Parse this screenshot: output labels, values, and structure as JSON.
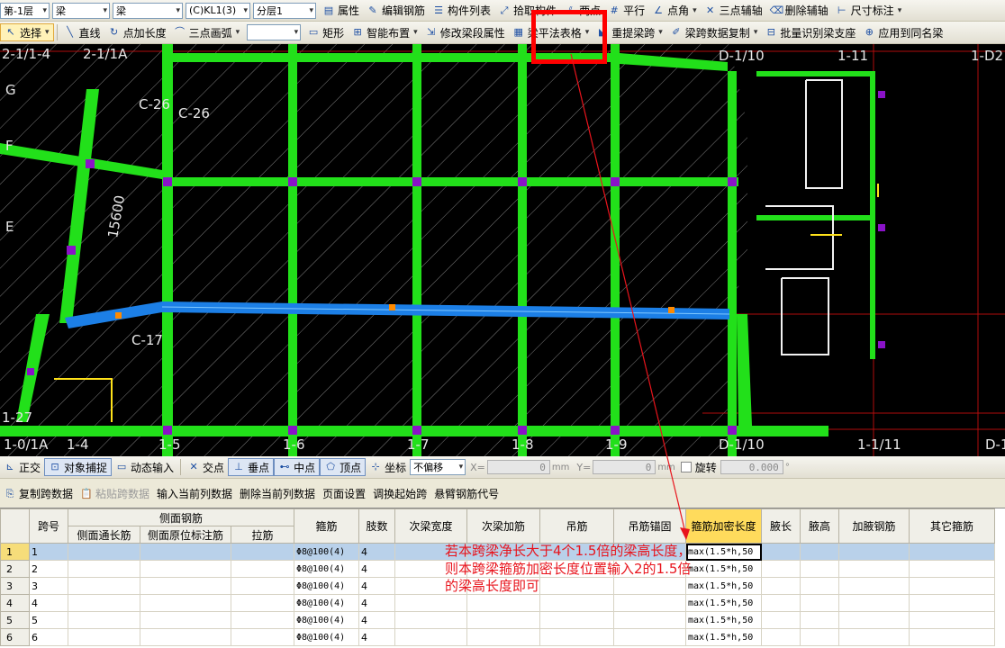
{
  "toolbar1": {
    "floor": "第-1层",
    "type1": "梁",
    "type2": "梁",
    "component": "(C)KL1(3)",
    "layer": "分层1",
    "items": [
      "属性",
      "编辑钢筋",
      "构件列表",
      "拾取构件",
      "两点",
      "平行",
      "点角",
      "三点辅轴",
      "删除辅轴",
      "尺寸标注"
    ]
  },
  "toolbar2": {
    "select": "选择",
    "items": [
      "直线",
      "点加长度",
      "三点画弧",
      "矩形",
      "智能布置",
      "修改梁段属性",
      "梁平法表格",
      "重提梁跨",
      "梁跨数据复制",
      "批量识别梁支座",
      "应用到同名梁"
    ]
  },
  "canvas": {
    "axis_labels": [
      "2-1/1-4",
      "2-1/1A",
      "D-1/10",
      "1-11",
      "1-D2",
      "1-0/1A",
      "1-4",
      "1-5",
      "1-6",
      "1-7",
      "1-8",
      "1-9",
      "D-1/10",
      "1-1/11",
      "D-1",
      "G",
      "F",
      "E",
      "C-26",
      "C-26",
      "C-17",
      "15600",
      "1-27"
    ]
  },
  "snapbar": {
    "items": [
      "正交",
      "对象捕捉",
      "动态输入",
      "交点",
      "垂点",
      "中点",
      "顶点",
      "坐标"
    ],
    "offset_mode": "不偏移",
    "x_label": "X=",
    "x_value": "0",
    "y_label": "Y=",
    "y_value": "0",
    "unit": "mm",
    "rotate_label": "旋转",
    "rotate_value": "0.000",
    "degree": "°"
  },
  "tablebar": {
    "items": [
      "复制跨数据",
      "粘贴跨数据",
      "输入当前列数据",
      "删除当前列数据",
      "页面设置",
      "调换起始跨",
      "悬臂钢筋代号"
    ]
  },
  "table": {
    "headers": {
      "span": "跨号",
      "side_group": "侧面钢筋",
      "side_long": "侧面通长筋",
      "side_orig": "侧面原位标注筋",
      "tie": "拉筋",
      "stirrup": "箍筋",
      "legs": "肢数",
      "sec_width": "次梁宽度",
      "sec_add": "次梁加筋",
      "hanger": "吊筋",
      "hanger_anchor": "吊筋锚固",
      "dense_len": "箍筋加密长度",
      "haunch_len": "腋长",
      "haunch_h": "腋高",
      "haunch_bar": "加腋钢筋",
      "other": "其它箍筋"
    },
    "rows": [
      {
        "idx": "1",
        "span": "1",
        "stirrup": "Φ8@100(4)",
        "legs": "4",
        "dense": "max(1.5*h,50"
      },
      {
        "idx": "2",
        "span": "2",
        "stirrup": "Φ8@100(4)",
        "legs": "4",
        "dense": "max(1.5*h,50"
      },
      {
        "idx": "3",
        "span": "3",
        "stirrup": "Φ8@100(4)",
        "legs": "4",
        "dense": "max(1.5*h,50"
      },
      {
        "idx": "4",
        "span": "4",
        "stirrup": "Φ8@100(4)",
        "legs": "4",
        "dense": "max(1.5*h,50"
      },
      {
        "idx": "5",
        "span": "5",
        "stirrup": "Φ8@100(4)",
        "legs": "4",
        "dense": "max(1.5*h,50"
      },
      {
        "idx": "6",
        "span": "6",
        "stirrup": "Φ8@100(4)",
        "legs": "4",
        "dense": "max(1.5*h,50"
      }
    ]
  },
  "annotation": "若本跨梁净长大于4个1.5倍的梁高长度，则本跨梁箍筋加密长度位置输入2的1.5倍的梁高长度即可",
  "colors": {
    "beam": "#22e01a",
    "selected_beam": "#1c7fe6",
    "column": "#8a12c8",
    "annotation": "#e8141c",
    "highlight": "#ff0000"
  }
}
